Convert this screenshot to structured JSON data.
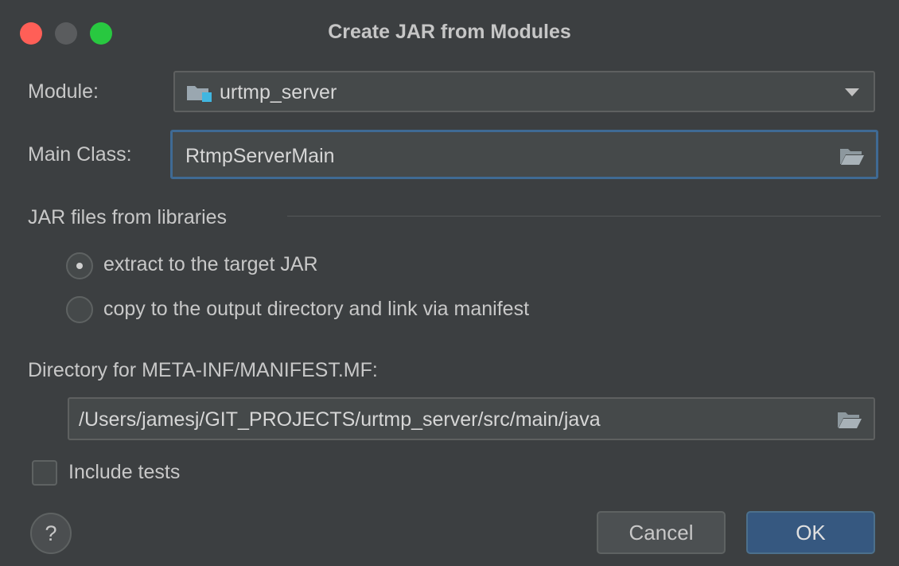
{
  "window": {
    "title": "Create JAR from Modules"
  },
  "module": {
    "label": "Module:",
    "value": "urtmp_server",
    "icon": "module-folder-icon"
  },
  "main_class": {
    "label": "Main Class:",
    "value": "RtmpServerMain",
    "icon": "folder-open-icon"
  },
  "libraries": {
    "section_label": "JAR files from libraries",
    "options": [
      {
        "label": "extract to the target JAR",
        "checked": true
      },
      {
        "label": "copy to the output directory and link via manifest",
        "checked": false
      }
    ]
  },
  "manifest": {
    "label": "Directory for META-INF/MANIFEST.MF:",
    "value": "/Users/jamesj/GIT_PROJECTS/urtmp_server/src/main/java",
    "icon": "folder-open-icon"
  },
  "include_tests": {
    "label": "Include tests",
    "checked": false
  },
  "footer": {
    "help_label": "?",
    "cancel_label": "Cancel",
    "ok_label": "OK"
  },
  "colors": {
    "background": "#3c3f41",
    "focus_border": "#3f6a94",
    "ok_button": "#365880",
    "close_light": "#ff5f57",
    "max_light": "#28c840"
  }
}
